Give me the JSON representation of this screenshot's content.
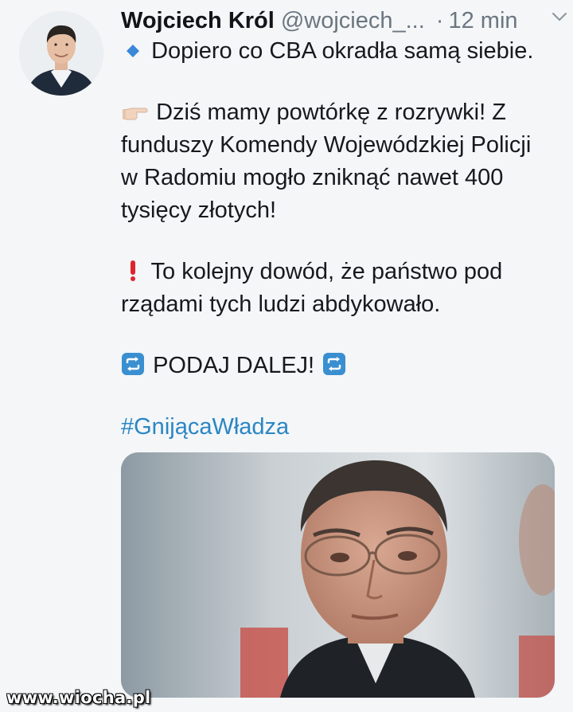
{
  "tweet": {
    "author_name": "Wojciech Król",
    "author_handle": "@wojciech_...",
    "dot": "·",
    "time": "12 min",
    "lines": {
      "l1": "Dopiero co CBA okradła samą siebie.",
      "l2": "Dziś mamy powtórkę z rozrywki! Z",
      "l3": "funduszy Komendy Wojewódzkiej Policji",
      "l4": "w Radomiu mogło zniknąć nawet 400",
      "l5": "tysięcy złotych!",
      "l6": "To kolejny dowód, że państwo pod",
      "l7": "rządami tych ludzi abdykowało.",
      "l8": "PODAJ DALEJ!",
      "hashtag": "#GnijącaWładza"
    }
  },
  "watermark": "www.wiocha.pl",
  "icons": {
    "bullet": "blue-diamond-icon",
    "pointing": "pointing-right-hand-icon",
    "exclamation": "red-exclamation-icon",
    "repeat": "repeat-arrows-icon",
    "menu": "chevron-down-icon"
  },
  "colors": {
    "background": "#f4f6f8",
    "text": "#16191d",
    "muted": "#6b7680",
    "hashtag": "#2a86c4",
    "repeat_icon": "#3a8fd0",
    "exclamation": "#e0242b",
    "diamond": "#3b87d8"
  }
}
